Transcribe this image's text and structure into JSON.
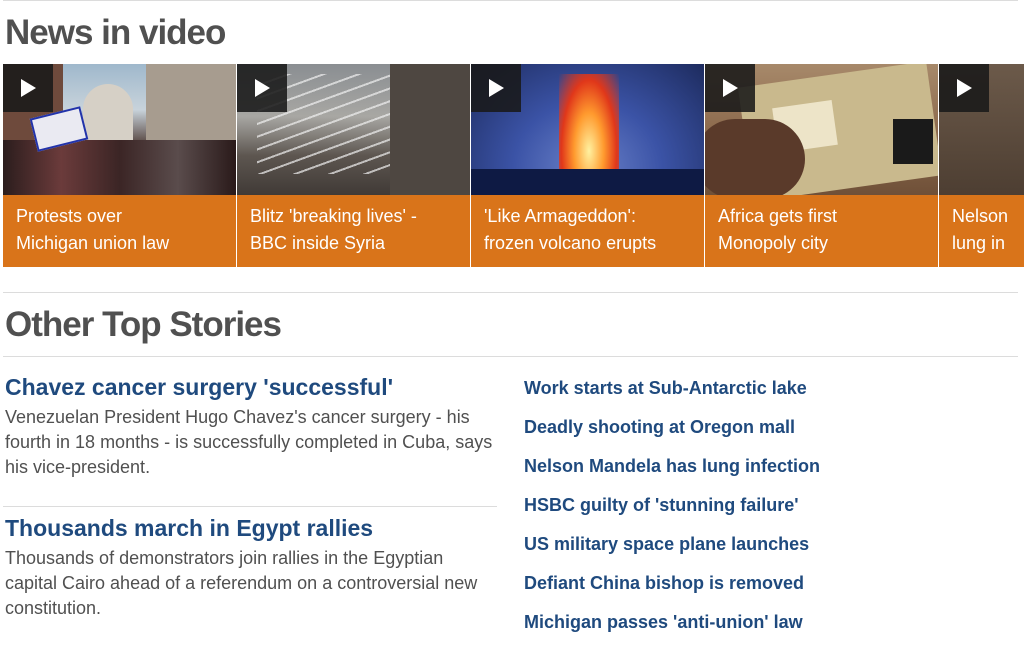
{
  "news_in_video": {
    "title": "News in video",
    "videos": [
      {
        "line1": "Protests over",
        "line2": "Michigan union law"
      },
      {
        "line1": "Blitz 'breaking lives' -",
        "line2": "BBC inside Syria"
      },
      {
        "line1": "'Like Armageddon':",
        "line2": "frozen volcano erupts"
      },
      {
        "line1": "Africa gets first",
        "line2": "Monopoly city"
      },
      {
        "line1": "Nelson",
        "line2": "lung in"
      }
    ]
  },
  "other_top_stories": {
    "title": "Other Top Stories",
    "featured": [
      {
        "headline": "Chavez cancer surgery 'successful'",
        "summary": "Venezuelan President Hugo Chavez's cancer surgery - his fourth in 18 months - is successfully completed in Cuba, says his vice-president."
      },
      {
        "headline": "Thousands march in Egypt rallies",
        "summary": "Thousands of demonstrators join rallies in the Egyptian capital Cairo ahead of a referendum on a controversial new constitution."
      }
    ],
    "headlines": [
      "Work starts at Sub-Antarctic lake",
      "Deadly shooting at Oregon mall",
      "Nelson Mandela has lung infection",
      "HSBC guilty of 'stunning failure'",
      "US military space plane launches",
      "Defiant China bishop is removed",
      "Michigan passes 'anti-union' law"
    ]
  },
  "colors": {
    "caption_bg": "#d9741a",
    "headline_link": "#1f4a7e",
    "section_title": "#505050"
  }
}
